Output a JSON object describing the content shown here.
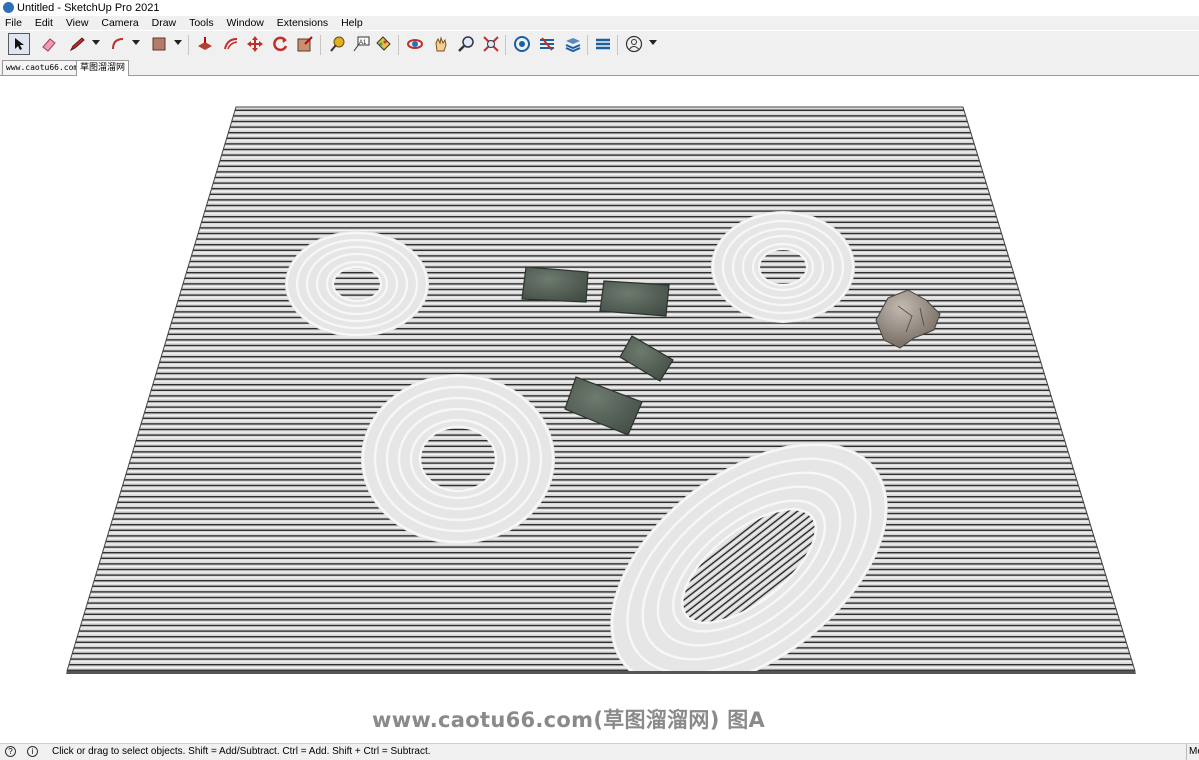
{
  "window": {
    "title": "Untitled - SketchUp Pro 2021"
  },
  "menu": {
    "items": [
      "File",
      "Edit",
      "View",
      "Camera",
      "Draw",
      "Tools",
      "Window",
      "Extensions",
      "Help"
    ]
  },
  "toolbar": {
    "tools": [
      "select-icon",
      "eraser-icon",
      "pencil-icon",
      "arc-icon",
      "shape-icon",
      "push-pull-icon",
      "offset-icon",
      "move-icon",
      "rotate-icon",
      "scale-icon",
      "tape-measure-icon",
      "text-icon",
      "paint-bucket-icon",
      "orbit-icon",
      "pan-icon",
      "zoom-icon",
      "zoom-extents-icon",
      "warehouse-icon",
      "extension-warehouse-icon",
      "layout-icon",
      "extension-manager-icon",
      "account-icon"
    ]
  },
  "tabs": {
    "items": [
      "www.caotu66.com",
      "草图溜溜网"
    ],
    "active": 1
  },
  "viewport": {
    "watermark": "www.caotu66.com(草图溜溜网) 图A"
  },
  "status": {
    "message": "Click or drag to select objects. Shift = Add/Subtract. Ctrl = Add. Shift + Ctrl = Subtract.",
    "measurements": "Me"
  }
}
